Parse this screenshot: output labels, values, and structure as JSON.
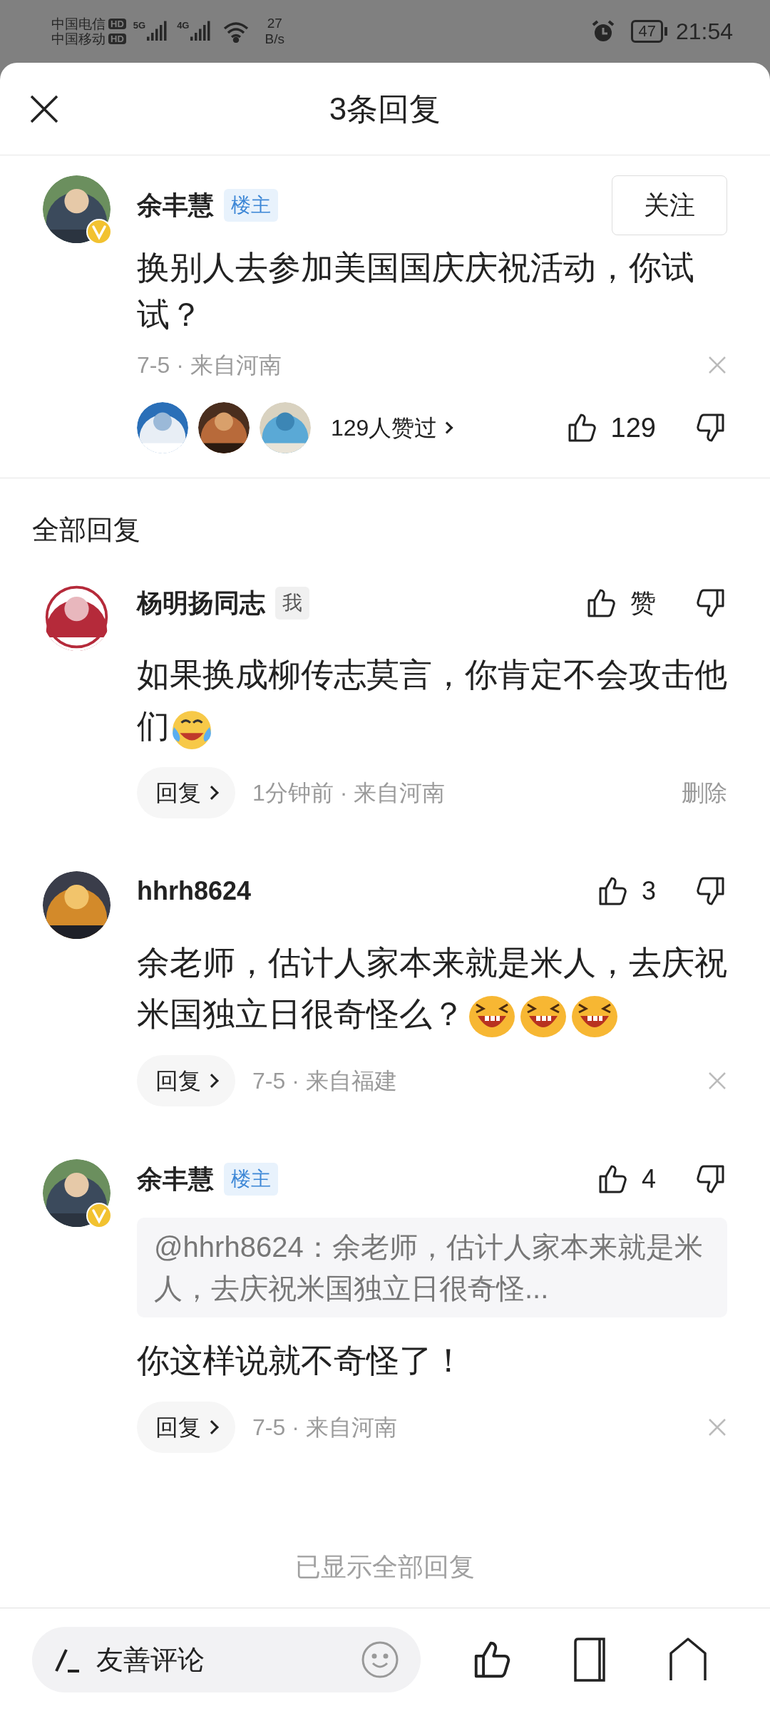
{
  "status_bar": {
    "carriers": [
      {
        "name": "中国电信",
        "badge": "HD"
      },
      {
        "name": "中国移动",
        "badge": "HD"
      }
    ],
    "signals": [
      "5G",
      "4G"
    ],
    "speed": [
      "27",
      "B/s"
    ],
    "alarm": true,
    "battery": "47",
    "time": "21:54"
  },
  "header": {
    "title": "3条回复"
  },
  "main_post": {
    "author": "余丰慧",
    "verified": true,
    "badge": {
      "kind": "owner",
      "text": "楼主"
    },
    "follow_label": "关注",
    "text": "换别人去参加美国国庆庆祝活动，你试试？",
    "meta": "7-5 · 来自河南",
    "likers_label": "129人赞过",
    "like_count": "129"
  },
  "section_title": "全部回复",
  "replies": [
    {
      "author": "杨明扬同志",
      "verified": false,
      "badge": {
        "kind": "self",
        "text": "我"
      },
      "like_label": "赞",
      "text": "如果换成柳传志莫言，你肯定不会攻击他们",
      "emojis": [
        {
          "kind": "tears"
        }
      ],
      "reply_label": "回复",
      "meta": "1分钟前 · 来自河南",
      "action": {
        "kind": "delete",
        "text": "删除"
      }
    },
    {
      "author": "hhrh8624",
      "verified": false,
      "like_label": "3",
      "text": "余老师，估计人家本来就是米人，去庆祝米国独立日很奇怪么？",
      "emojis": [
        {
          "kind": "laugh"
        },
        {
          "kind": "laugh"
        },
        {
          "kind": "laugh"
        }
      ],
      "reply_label": "回复",
      "meta": "7-5 · 来自福建",
      "action": {
        "kind": "close"
      }
    },
    {
      "author": "余丰慧",
      "verified": true,
      "badge": {
        "kind": "owner",
        "text": "楼主"
      },
      "like_label": "4",
      "quote": "@hhrh8624：余老师，估计人家本来就是米人，去庆祝米国独立日很奇怪...",
      "text": "你这样说就不奇怪了！",
      "reply_label": "回复",
      "meta": "7-5 · 来自河南",
      "action": {
        "kind": "close"
      }
    }
  ],
  "footer_note": "已显示全部回复",
  "bottom_bar": {
    "placeholder": "友善评论"
  }
}
